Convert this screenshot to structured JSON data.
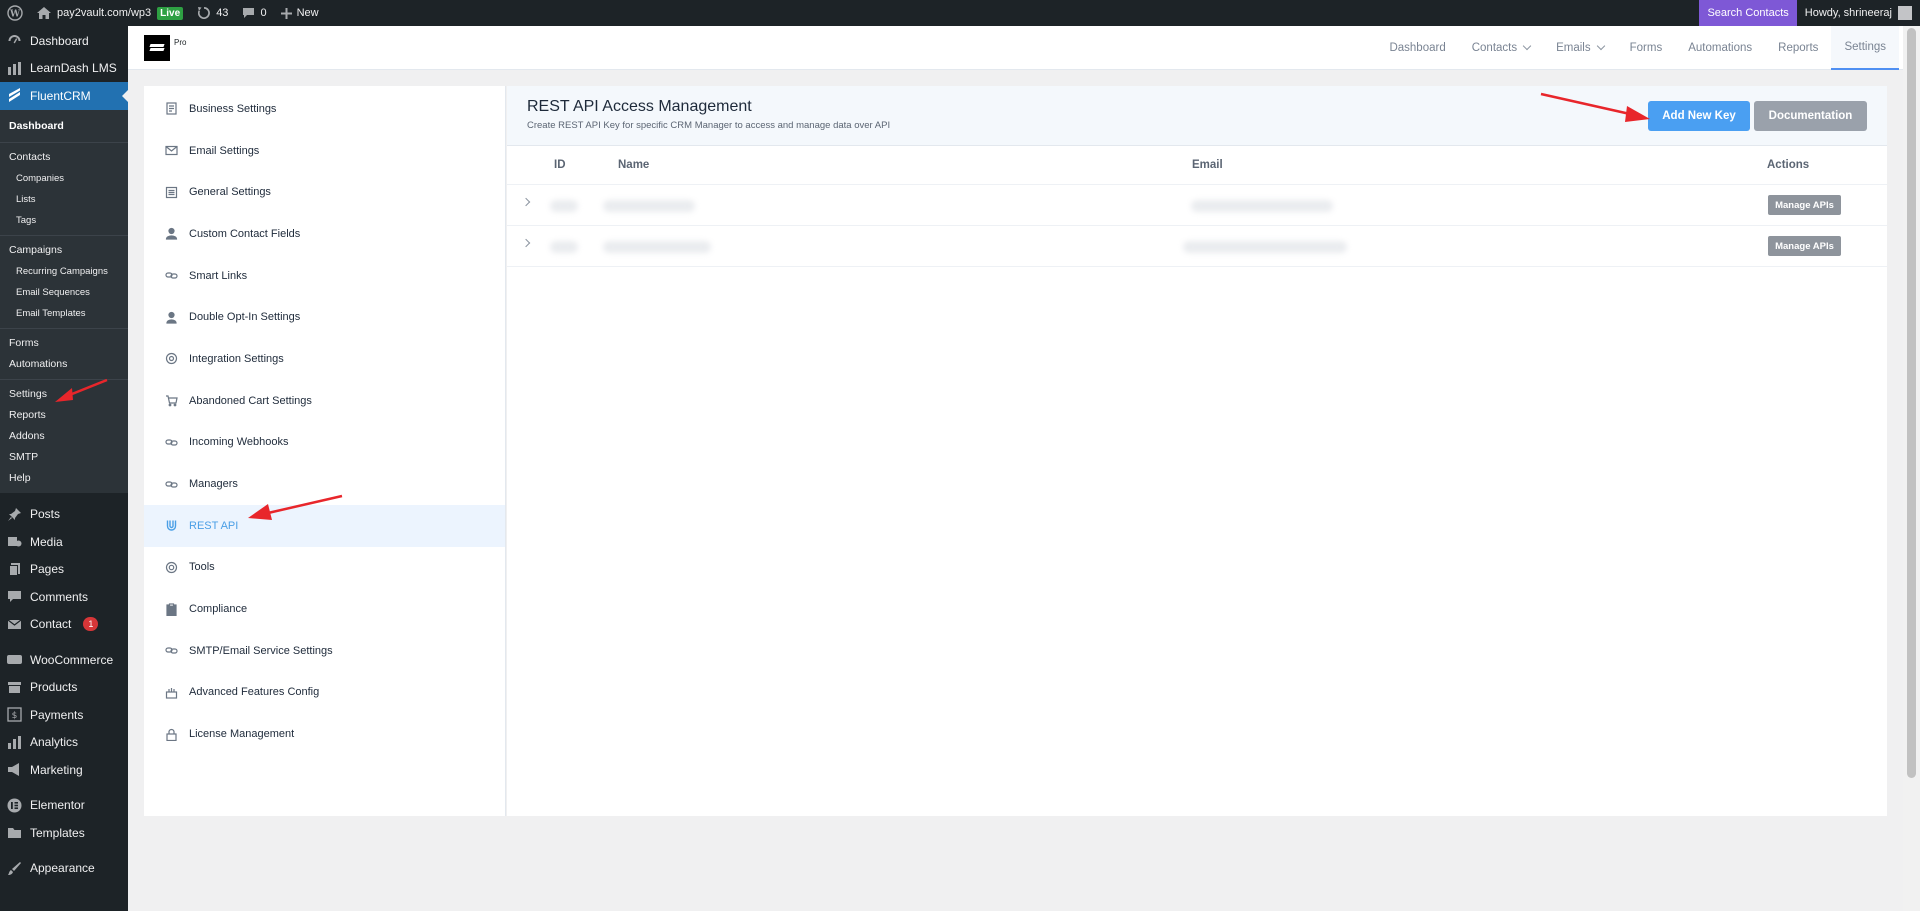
{
  "admin_bar": {
    "site_name": "pay2vault.com/wp3",
    "live_label": "Live",
    "updates_count": "43",
    "comments_count": "0",
    "new_label": "New",
    "search_contacts": "Search Contacts",
    "howdy": "Howdy, shrineeraj"
  },
  "wp_menu": {
    "dashboard": "Dashboard",
    "learndash": "LearnDash LMS",
    "fluentcrm": "FluentCRM",
    "submenu": {
      "dashboard": "Dashboard",
      "contacts": "Contacts",
      "companies": "Companies",
      "lists": "Lists",
      "tags": "Tags",
      "campaigns": "Campaigns",
      "recurring": "Recurring Campaigns",
      "sequences": "Email Sequences",
      "templates": "Email Templates",
      "forms": "Forms",
      "automations": "Automations",
      "settings": "Settings",
      "reports": "Reports",
      "addons": "Addons",
      "smtp": "SMTP",
      "help": "Help"
    },
    "posts": "Posts",
    "media": "Media",
    "pages": "Pages",
    "comments": "Comments",
    "contact": "Contact",
    "contact_badge": "1",
    "woocommerce": "WooCommerce",
    "products": "Products",
    "payments": "Payments",
    "analytics": "Analytics",
    "marketing": "Marketing",
    "elementor": "Elementor",
    "templates": "Templates",
    "appearance": "Appearance"
  },
  "top_nav": {
    "pro_label": "Pro",
    "items": [
      "Dashboard",
      "Contacts",
      "Emails",
      "Forms",
      "Automations",
      "Reports",
      "Settings"
    ]
  },
  "settings_menu": [
    "Business Settings",
    "Email Settings",
    "General Settings",
    "Custom Contact Fields",
    "Smart Links",
    "Double Opt-In Settings",
    "Integration Settings",
    "Abandoned Cart Settings",
    "Incoming Webhooks",
    "Managers",
    "REST API",
    "Tools",
    "Compliance",
    "SMTP/Email Service Settings",
    "Advanced Features Config",
    "License Management"
  ],
  "panel": {
    "title": "REST API Access Management",
    "description": "Create REST API Key for specific CRM Manager to access and manage data over API",
    "add_button": "Add New Key",
    "doc_button": "Documentation",
    "columns": {
      "id": "ID",
      "name": "Name",
      "email": "Email",
      "actions": "Actions"
    },
    "manage_label": "Manage APIs"
  },
  "colors": {
    "accent_blue": "#4a9ff2",
    "wp_blue": "#2271b1",
    "annotation_red": "#e8262b"
  }
}
